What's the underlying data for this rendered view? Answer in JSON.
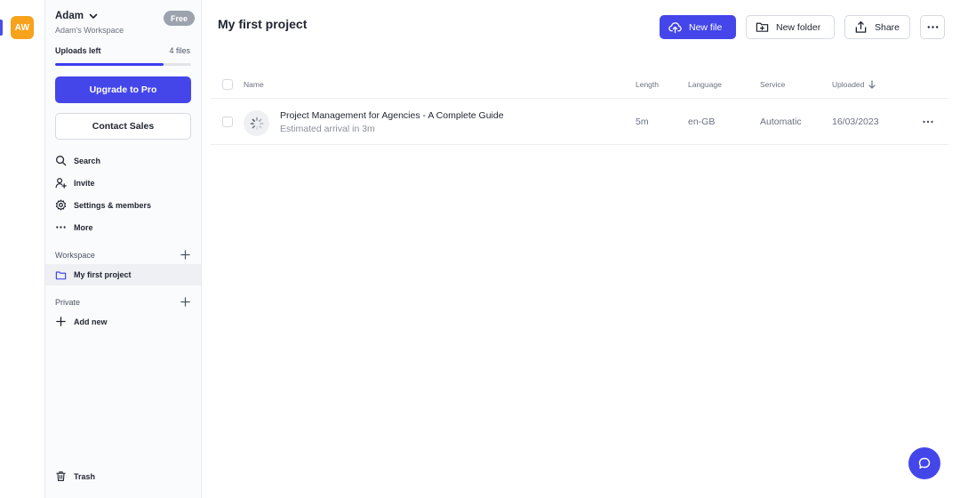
{
  "workspace": {
    "initials": "AW",
    "color": "#f7a21b"
  },
  "user": {
    "name": "Adam",
    "workspace_name": "Adam's Workspace",
    "plan_badge": "Free"
  },
  "uploads": {
    "label": "Uploads left",
    "count": "4 files",
    "progress": 0.8
  },
  "buttons": {
    "upgrade": "Upgrade to Pro",
    "contact_sales": "Contact Sales"
  },
  "nav": {
    "search": "Search",
    "invite": "Invite",
    "settings": "Settings & members",
    "more": "More"
  },
  "sections": {
    "workspace_label": "Workspace",
    "project_name": "My first project",
    "private_label": "Private",
    "add_new": "Add new"
  },
  "trash": "Trash",
  "page": {
    "title": "My first project"
  },
  "toolbar": {
    "new_file": "New file",
    "new_folder": "New folder",
    "share": "Share"
  },
  "table": {
    "headers": {
      "name": "Name",
      "length": "Length",
      "language": "Language",
      "service": "Service",
      "uploaded": "Uploaded"
    },
    "rows": [
      {
        "title": "Project Management for Agencies - A Complete Guide",
        "status": "Estimated arrival in 3m",
        "length": "5m",
        "language": "en-GB",
        "service": "Automatic",
        "uploaded": "16/03/2023"
      }
    ]
  },
  "colors": {
    "accent": "#4446ea",
    "badge": "#9ca3af",
    "selected": "#eef0f3"
  },
  "icons": [
    "chevron-down-icon",
    "search-icon",
    "invite-icon",
    "gear-icon",
    "more-icon",
    "plus-icon",
    "folder-icon",
    "trash-icon",
    "upload-cloud-icon",
    "folder-plus-icon",
    "share-icon",
    "spinner-icon",
    "arrow-down-icon",
    "chat-bubble-icon"
  ]
}
